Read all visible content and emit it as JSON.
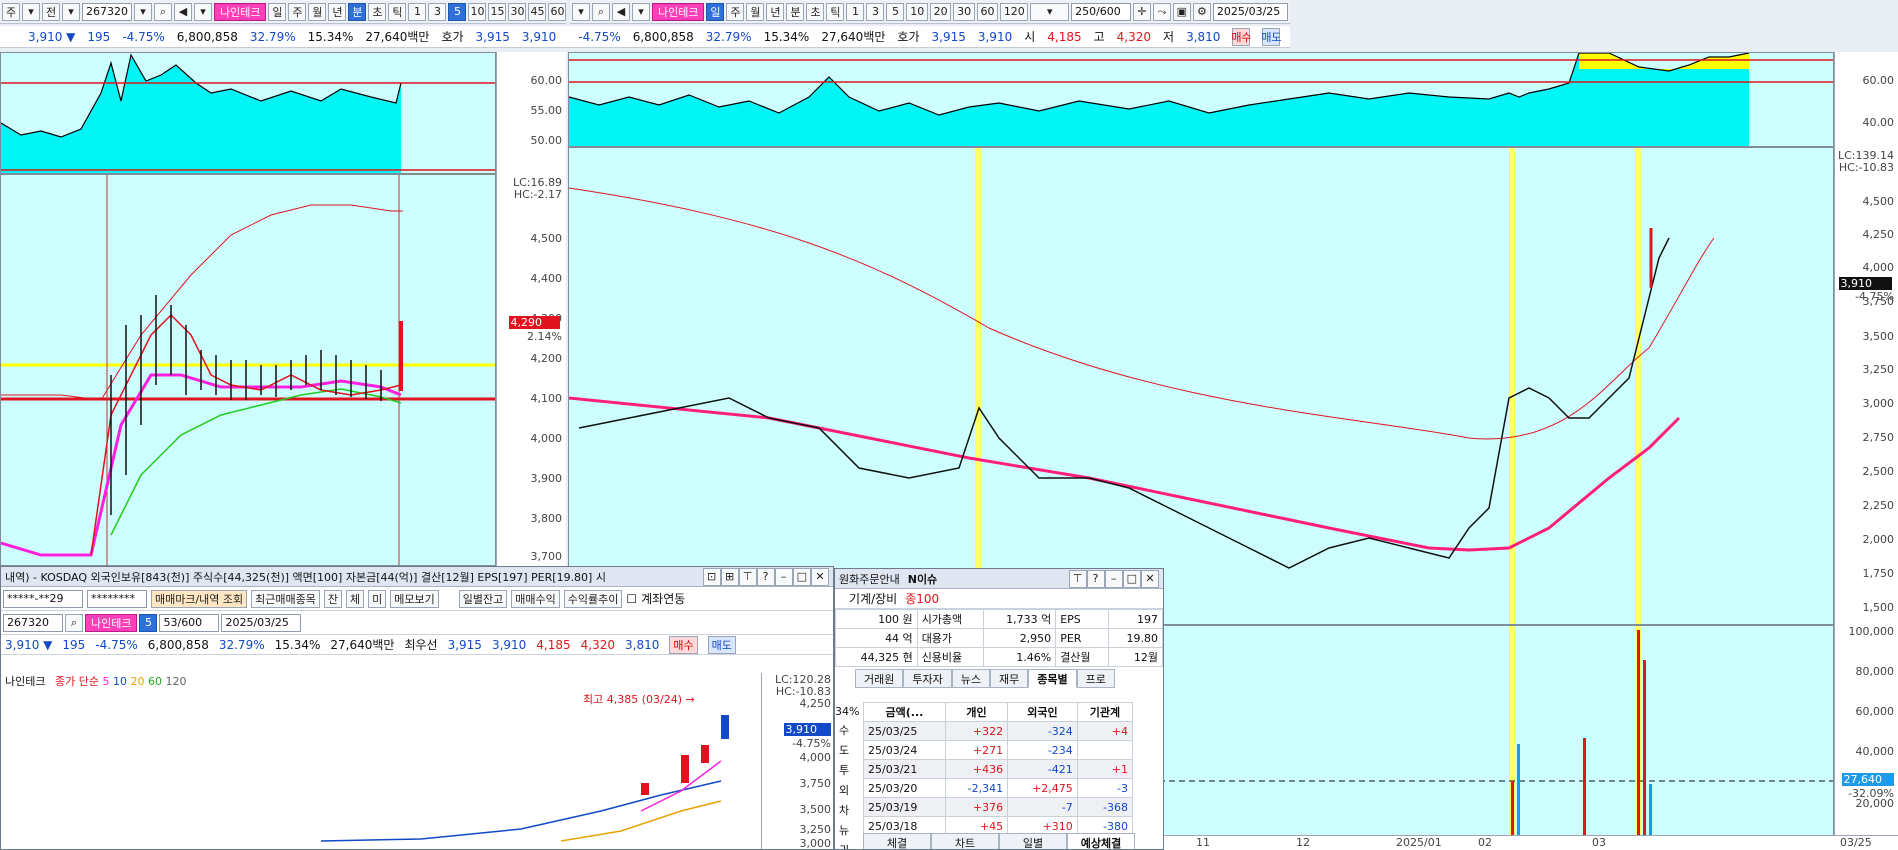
{
  "left_toolbar": {
    "mode1": "주",
    "mode2": "전",
    "code": "267320",
    "name": "나인테크",
    "periods": [
      "일",
      "주",
      "월",
      "년",
      "분",
      "초",
      "틱"
    ],
    "selected_period": "분",
    "intervals": [
      "1",
      "3",
      "5",
      "10",
      "15",
      "30",
      "45",
      "60"
    ],
    "selected_interval": "5"
  },
  "right_toolbar": {
    "name": "나인테크",
    "periods": [
      "일",
      "주",
      "월",
      "년",
      "분",
      "초",
      "틱"
    ],
    "selected_period": "일",
    "intervals": [
      "1",
      "3",
      "5",
      "10",
      "20",
      "30",
      "60",
      "120"
    ],
    "count": "250/600",
    "date": "2025/03/25"
  },
  "quote": {
    "price": "3,910 ▼",
    "change": "195",
    "rate": "-4.75%",
    "volume": "6,800,858",
    "turnover": "32.79%",
    "ratio": "15.34%",
    "amount": "27,640백만",
    "hoga_label": "호가",
    "ask": "3,915",
    "bid": "3,910",
    "open_label": "시",
    "open": "4,185",
    "high_label": "고",
    "high": "4,320",
    "low_label": "저",
    "low": "3,810",
    "buy": "매수",
    "sell": "매도",
    "extra": "평"
  },
  "left_osc_axis": [
    "60.00",
    "55.00",
    "50.00"
  ],
  "left_price_axis": [
    "4,500",
    "4,400",
    "4,300",
    "4,200",
    "4,100",
    "4,000",
    "3,900",
    "3,800",
    "3,700"
  ],
  "left_lc": "LC:16.89",
  "left_hc": "HC:-2.17",
  "left_current": "4,290",
  "left_current_rate": "2.14%",
  "right_osc_axis": [
    "60.00",
    "40.00"
  ],
  "right_price_axis": [
    "4,500",
    "4,250",
    "4,000",
    "3,750",
    "3,500",
    "3,250",
    "3,000",
    "2,750",
    "2,500",
    "2,250",
    "2,000",
    "1,750",
    "1,500"
  ],
  "right_lc": "LC:139.14",
  "right_hc": "HC:-10.83",
  "right_current": "3,910",
  "right_current_rate": "-4.75%",
  "right_vol_axis": [
    "100,000",
    "80,000",
    "60,000",
    "40,000",
    "20,000"
  ],
  "right_vol_current": "27,640",
  "right_vol_rate": "-32.09%",
  "right_x_axis": [
    "11",
    "12",
    "2025/01",
    "02",
    "03",
    "03/25"
  ],
  "popup1": {
    "title": "내역) - KOSDAQ 외국인보유[843(천)] 주식수[44,325(천)] 액면[100] 자본금[44(억)] 결산[12월] EPS[197] PER[19.80] 시",
    "account": "*****-**29",
    "password": "********",
    "buttons": [
      "매매마크/내역 조회",
      "최근매매종목",
      "잔",
      "체",
      "미",
      "메모보기",
      "일별잔고",
      "매매수익",
      "수익률추이",
      "계좌연동"
    ],
    "code": "267320",
    "name": "나인테크",
    "interval": "5",
    "count": "53/600",
    "date": "2025/03/25",
    "quote": {
      "price": "3,910 ▼",
      "change": "195",
      "rate": "-4.75%",
      "volume": "6,800,858",
      "turnover": "32.79%",
      "ratio": "15.34%",
      "amount": "27,640백만",
      "hoga": "최우선",
      "ask": "3,915",
      "bid": "3,910",
      "open": "4,185",
      "high": "4,320",
      "low": "3,810",
      "buy": "매수",
      "sell": "매도"
    },
    "legend": "나인테크",
    "ma_label": "종가 단순",
    "ma_periods": [
      "5",
      "10",
      "20",
      "60",
      "120"
    ],
    "high_note": "최고 4,385 (03/24) →",
    "lc": "LC:120.28",
    "hc": "HC:-10.83",
    "axis": [
      "4,250",
      "4,000",
      "3,750",
      "3,500",
      "3,250",
      "3,000"
    ],
    "current": "3,910",
    "current_rate": "-4.75%"
  },
  "popup2": {
    "title": "원화주문안내",
    "news": "N이슈",
    "sector": "기계/장비",
    "index": "종100",
    "info": [
      [
        "100 원",
        "시가총액",
        "1,733 억",
        "EPS",
        "197"
      ],
      [
        "44 억",
        "대용가",
        "2,950",
        "PER",
        "19.80"
      ],
      [
        "44,325 현",
        "신용비율",
        "1.46%",
        "결산월",
        "12월"
      ]
    ],
    "tabs": [
      "거래원",
      "투자자",
      "뉴스",
      "재무",
      "종목별",
      "프로"
    ],
    "selected_tab": "종목별",
    "headers": [
      "금액(...",
      "개인",
      "외국인",
      "기관계"
    ],
    "rows": [
      [
        "25/03/25",
        "+322",
        "-324",
        "+4"
      ],
      [
        "25/03/24",
        "+271",
        "-234",
        ""
      ],
      [
        "25/03/21",
        "+436",
        "-421",
        "+1"
      ],
      [
        "25/03/20",
        "-2,341",
        "+2,475",
        "-3"
      ],
      [
        "25/03/19",
        "+376",
        "-7",
        "-368"
      ],
      [
        "25/03/18",
        "+45",
        "+310",
        "-380"
      ]
    ],
    "side": [
      "34%",
      "수",
      "도",
      "투",
      "외",
      "차",
      "뉴",
      "권"
    ],
    "bottom_tabs": [
      "체결",
      "차트",
      "일별",
      "예상체결"
    ]
  },
  "colors": {
    "up": "#e0141e",
    "down": "#1149c7",
    "pane": "#ccfffe",
    "osc": "#00f5f7",
    "yellow": "#ffff00",
    "pink": "#ff3fb8"
  }
}
